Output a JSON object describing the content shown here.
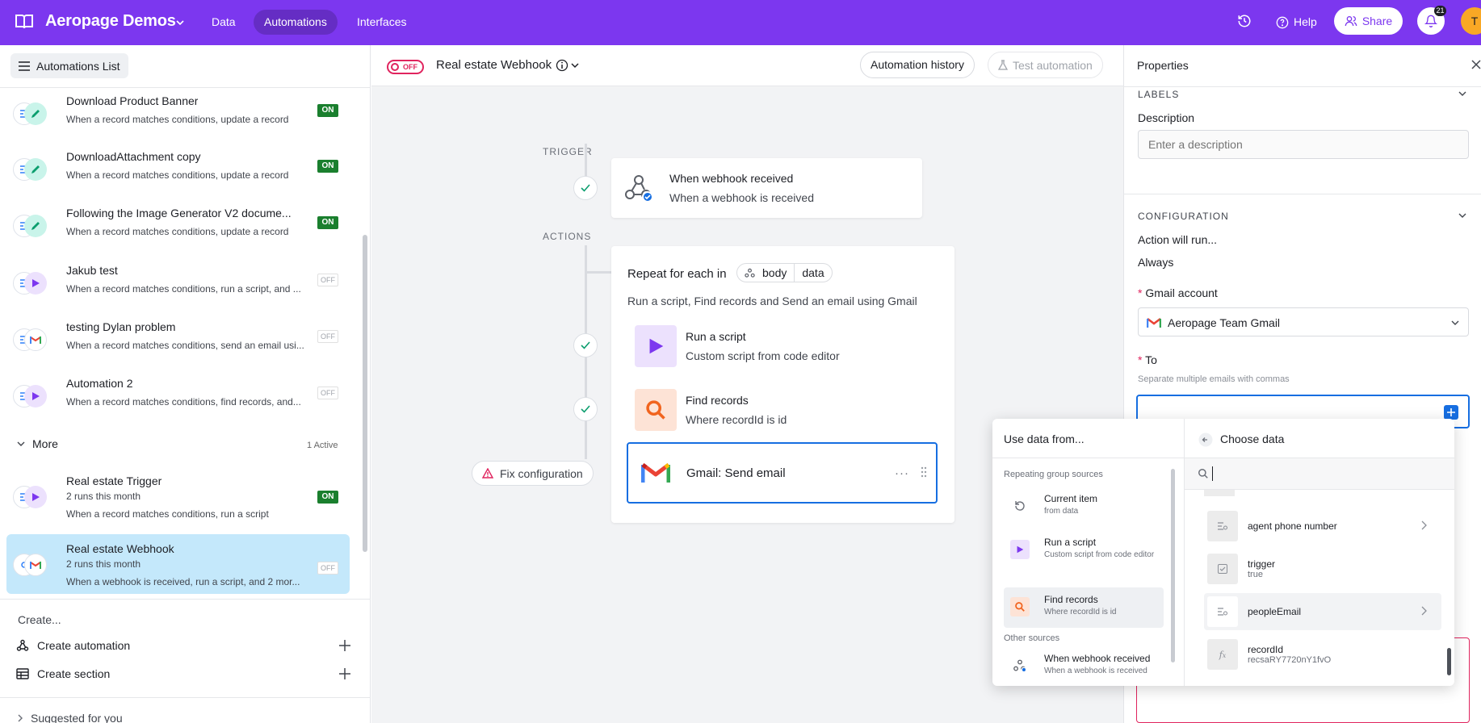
{
  "topbar": {
    "brand": "Aeropage Demos",
    "tabs": [
      "Data",
      "Automations",
      "Interfaces"
    ],
    "help": "Help",
    "share": "Share",
    "notifications_count": "21",
    "avatar_initial": "T",
    "accent": "#7c37ef"
  },
  "left": {
    "list_button": "Automations List",
    "items": [
      {
        "name": "Download Product Banner",
        "desc": "When a record matches conditions, update a record",
        "status": "ON"
      },
      {
        "name": "DownloadAttachment copy",
        "desc": "When a record matches conditions, update a record",
        "status": "ON"
      },
      {
        "name": "Following the Image Generator V2 docume...",
        "desc": "When a record matches conditions, update a record",
        "status": "ON"
      },
      {
        "name": "Jakub test",
        "desc": "When a record matches conditions, run a script, and ...",
        "status": "OFF"
      },
      {
        "name": "testing Dylan problem",
        "desc": "When a record matches conditions, send an email usi...",
        "status": "OFF"
      },
      {
        "name": "Automation 2",
        "desc": "When a record matches conditions, find records, and...",
        "status": "OFF"
      }
    ],
    "more_label": "More",
    "more_active": "1 Active",
    "more_items": [
      {
        "name": "Real estate Trigger",
        "runs": "2 runs this month",
        "desc": "When a record matches conditions, run a script",
        "status": "ON"
      },
      {
        "name": "Real estate Webhook",
        "runs": "2 runs this month",
        "desc": "When a webhook is received, run a script, and 2 mor...",
        "status": "OFF"
      }
    ],
    "create_label": "Create...",
    "create_automation": "Create automation",
    "create_section": "Create section",
    "suggested": "Suggested for you"
  },
  "canvas": {
    "toggle": "OFF",
    "title": "Real estate Webhook",
    "history_button": "Automation history",
    "test_button": "Test automation",
    "trigger_label": "TRIGGER",
    "actions_label": "ACTIONS",
    "trigger": {
      "title": "When webhook received",
      "subtitle": "When a webhook is received"
    },
    "repeat": {
      "title": "Repeat for each in",
      "pill_a": "body",
      "pill_b": "data",
      "subtitle": "Run a script, Find records and Send an email using Gmail"
    },
    "steps": [
      {
        "title": "Run a script",
        "subtitle": "Custom script from code editor"
      },
      {
        "title": "Find records",
        "subtitle": "Where recordId is id"
      }
    ],
    "gmail": {
      "title": "Gmail: Send email"
    },
    "fix_button": "Fix configuration"
  },
  "props": {
    "title": "Properties",
    "labels_head": "LABELS",
    "description_label": "Description",
    "description_placeholder": "Enter a description",
    "config_head": "CONFIGURATION",
    "action_runs_label": "Action will run...",
    "action_runs_value": "Always",
    "gmail_account_label": "Gmail account",
    "gmail_account_value": "Aeropage Team Gmail",
    "to_label": "To",
    "to_hint": "Separate multiple emails with commas",
    "to_value": ""
  },
  "picker": {
    "use_data_from": "Use data from...",
    "choose_data": "Choose data",
    "repeating_head": "Repeating group sources",
    "other_head": "Other sources",
    "sources": [
      {
        "name": "Current item",
        "desc": "from data"
      },
      {
        "name": "Run a script",
        "desc": "Custom script from code editor"
      },
      {
        "name": "Find records",
        "desc": "Where recordId is id"
      },
      {
        "name": "When webhook received",
        "desc": "When a webhook is received"
      }
    ],
    "fields": [
      {
        "name": "agent phone number",
        "value": ""
      },
      {
        "name": "trigger",
        "value": "true"
      },
      {
        "name": "peopleEmail",
        "value": ""
      },
      {
        "name": "recordId",
        "value": "recsaRY7720nY1fvO"
      }
    ]
  }
}
